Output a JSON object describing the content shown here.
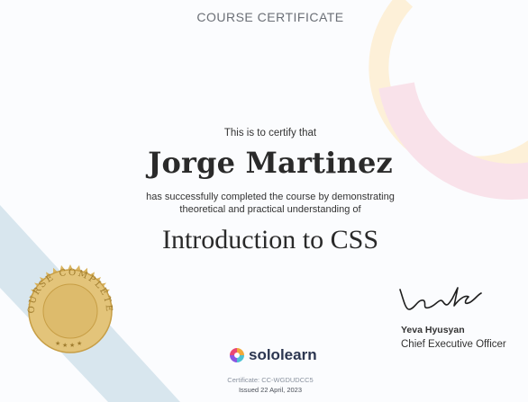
{
  "header": {
    "title": "COURSE CERTIFICATE"
  },
  "certificate": {
    "intro": "This is to certify that",
    "recipient_name": "Jorge Martinez",
    "description_line1": "has successfully completed the course by demonstrating",
    "description_line2": "theoretical and practical understanding of",
    "course_name": "Introduction to CSS"
  },
  "brand": {
    "logo_text": "sololearn"
  },
  "footer": {
    "certificate_number": "Certificate: CC-WGDUDCC5",
    "issued_date": "Issued 22 April, 2023"
  },
  "signatory": {
    "name": "Yeva Hyusyan",
    "title": "Chief Executive Officer"
  },
  "seal": {
    "text": "COURSE COMPLETED"
  },
  "colors": {
    "background": "#fbfcfe",
    "seal_gold": "#d6b25f",
    "ribbon_blue": "#d8e6ee",
    "accent_pink": "#f9e2ea",
    "accent_cream": "#fdf0d8"
  }
}
